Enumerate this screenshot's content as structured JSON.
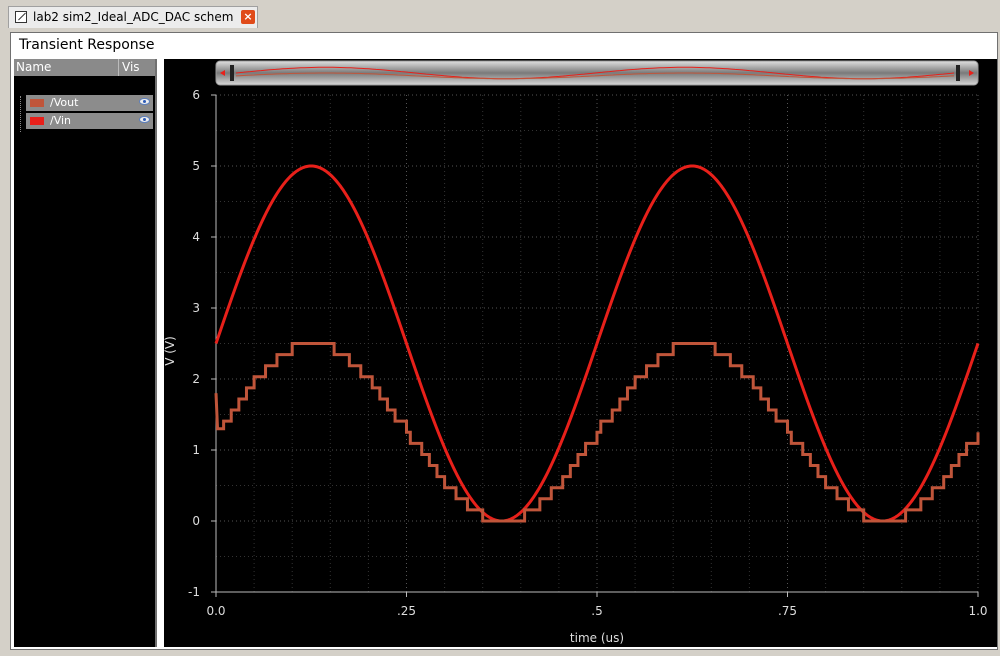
{
  "tab": {
    "label": "lab2 sim2_Ideal_ADC_DAC schem...",
    "close": "×"
  },
  "title": "Transient Response",
  "panel_header": {
    "name": "Name",
    "vis": "Vis"
  },
  "signals": [
    {
      "name": "/Vout",
      "color": "#c0553a"
    },
    {
      "name": "/Vin",
      "color": "#e8201a"
    }
  ],
  "chart_data": {
    "type": "line",
    "xlabel": "time (us)",
    "ylabel": "V (V)",
    "xlim": [
      0,
      1.0
    ],
    "ylim": [
      -1,
      6
    ],
    "xticks": [
      "0.0",
      ".25",
      ".5",
      ".75",
      "1.0"
    ],
    "yticks": [
      "-1",
      "0",
      "1",
      "2",
      "3",
      "4",
      "5",
      "6"
    ],
    "grid": true,
    "series": [
      {
        "name": "/Vin",
        "color": "#e8201a",
        "x": [
          0,
          0.125,
          0.25,
          0.375,
          0.5,
          0.625,
          0.75,
          0.875,
          1.0
        ],
        "y": [
          2.5,
          5.0,
          2.5,
          0.0,
          2.5,
          5.0,
          2.5,
          0.0,
          2.5
        ]
      },
      {
        "name": "/Vout",
        "color": "#c0553a",
        "x": [
          0,
          0.002,
          0.005,
          0.125,
          0.25,
          0.375,
          0.5,
          0.625,
          0.75,
          0.875,
          1.0
        ],
        "y": [
          1.8,
          1.3,
          1.3,
          2.5,
          1.25,
          0.0,
          1.25,
          2.5,
          1.25,
          0.0,
          1.17
        ]
      }
    ]
  }
}
